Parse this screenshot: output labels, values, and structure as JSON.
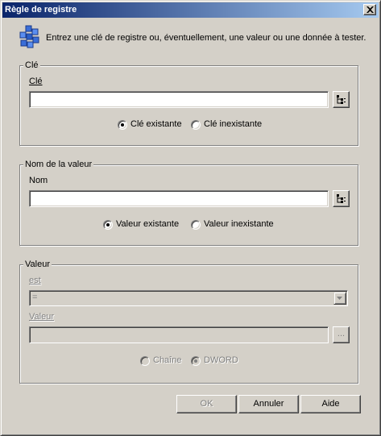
{
  "window": {
    "title": "Règle de registre"
  },
  "header": {
    "icon": "registry-blocks-icon",
    "instruction": "Entrez une clé de registre ou, éventuellement, une valeur ou une donnée à tester."
  },
  "key_group": {
    "legend": "Clé",
    "field_label": "Clé",
    "field_value": "",
    "radios": [
      {
        "label": "Clé existante",
        "checked": true,
        "enabled": true
      },
      {
        "label": "Clé inexistante",
        "checked": false,
        "enabled": true
      }
    ]
  },
  "value_name_group": {
    "legend": "Nom de la valeur",
    "field_label": "Nom",
    "field_value": "",
    "radios": [
      {
        "label": "Valeur existante",
        "checked": true,
        "enabled": true
      },
      {
        "label": "Valeur inexistante",
        "checked": false,
        "enabled": false
      }
    ]
  },
  "value_group": {
    "legend": "Valeur",
    "operator_label": "est",
    "operator_value": "=",
    "value_label": "Valeur",
    "value_field": "",
    "browse_label": "...",
    "radios": [
      {
        "label": "Chaîne",
        "checked": false,
        "enabled": false
      },
      {
        "label": "DWORD",
        "checked": true,
        "enabled": false
      }
    ]
  },
  "buttons": {
    "ok": "OK",
    "cancel": "Annuler",
    "help": "Aide"
  },
  "colors": {
    "face": "#d4d0c8",
    "title_start": "#0a246a",
    "title_end": "#a6caf0",
    "disabled_text": "#808080"
  }
}
